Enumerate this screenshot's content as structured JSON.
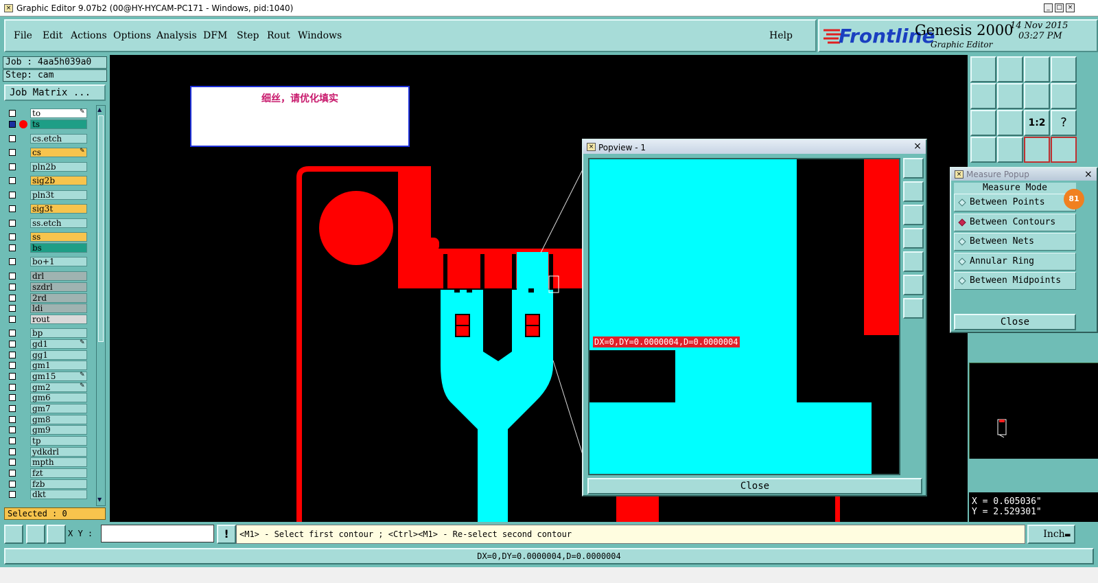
{
  "window": {
    "title": "Graphic Editor 9.07b2 (00@HY-HYCAM-PC171 - Windows, pid:1040)"
  },
  "menu": {
    "items": [
      "File",
      "Edit",
      "Actions",
      "Options",
      "Analysis",
      "DFM",
      "Step",
      "Rout",
      "Windows"
    ],
    "help": "Help"
  },
  "brand": {
    "logo": "Frontline",
    "product": "Genesis 2000",
    "subtitle": "Graphic Editor",
    "date": "14 Nov 2015",
    "time": "03:27 PM"
  },
  "job": {
    "job_label": "Job : 4aa5h039a0",
    "step_label": "Step: cam",
    "matrix_button": "Job Matrix ..."
  },
  "layers": [
    {
      "name": "to",
      "color": "#ffffff",
      "mark": "pen"
    },
    {
      "name": "ts",
      "color": "#1e9e86",
      "mark": "dot"
    },
    {
      "name": "cs.etch",
      "color": "#a7dcd8"
    },
    {
      "name": "cs",
      "color": "#f7c44d",
      "mark": "pen"
    },
    {
      "name": "pln2b",
      "color": "#a7dcd8"
    },
    {
      "name": "sig2b",
      "color": "#f7c44d"
    },
    {
      "name": "pln3t",
      "color": "#a7dcd8"
    },
    {
      "name": "sig3t",
      "color": "#f7c44d"
    },
    {
      "name": "ss.etch",
      "color": "#a7dcd8"
    },
    {
      "name": "ss",
      "color": "#f7c44d"
    },
    {
      "name": "bs",
      "color": "#1e9e86"
    },
    {
      "name": "bo+1",
      "color": "#a7dcd8"
    },
    {
      "name": "drl",
      "color": "#9fb3b1"
    },
    {
      "name": "szdrl",
      "color": "#9fb3b1"
    },
    {
      "name": "2rd",
      "color": "#9fb3b1"
    },
    {
      "name": "ldi",
      "color": "#9fb3b1"
    },
    {
      "name": "rout",
      "color": "#d9d9d9"
    },
    {
      "name": "bp",
      "color": "#a7dcd8"
    },
    {
      "name": "gd1",
      "color": "#a7dcd8",
      "mark": "pen"
    },
    {
      "name": "gg1",
      "color": "#a7dcd8"
    },
    {
      "name": "gm1",
      "color": "#a7dcd8"
    },
    {
      "name": "gm15",
      "color": "#a7dcd8",
      "mark": "pen"
    },
    {
      "name": "gm2",
      "color": "#a7dcd8",
      "mark": "pen"
    },
    {
      "name": "gm6",
      "color": "#a7dcd8"
    },
    {
      "name": "gm7",
      "color": "#a7dcd8"
    },
    {
      "name": "gm8",
      "color": "#a7dcd8"
    },
    {
      "name": "gm9",
      "color": "#a7dcd8"
    },
    {
      "name": "tp",
      "color": "#a7dcd8"
    },
    {
      "name": "ydkdrl",
      "color": "#a7dcd8"
    },
    {
      "name": "mpth",
      "color": "#a7dcd8"
    },
    {
      "name": "fzt",
      "color": "#a7dcd8"
    },
    {
      "name": "fzb",
      "color": "#a7dcd8"
    },
    {
      "name": "dkt",
      "color": "#a7dcd8"
    }
  ],
  "selected": "Selected : 0",
  "note": {
    "text": "细丝，请优化填实"
  },
  "popview": {
    "title": "Popview - 1",
    "measure_label": "DX=0,DY=0.0000004,D=0.0000004",
    "close": "Close"
  },
  "measure_popup": {
    "title": "Measure Popup",
    "header": "Measure Mode",
    "options": [
      {
        "label": "Between Points",
        "selected": false
      },
      {
        "label": "Between Contours",
        "selected": true
      },
      {
        "label": "Between Nets",
        "selected": false
      },
      {
        "label": "Annular Ring",
        "selected": false
      },
      {
        "label": "Between Midpoints",
        "selected": false
      }
    ],
    "close": "Close",
    "badge": "81"
  },
  "coords": {
    "x": "X = 0.605036\"",
    "y": "Y = 2.529301\""
  },
  "command": {
    "xy_label": "X Y :",
    "xy_value": "",
    "warn": "!",
    "prompt": "<M1> - Select first contour ; <Ctrl><M1> - Re-select second contour",
    "unit": "Inch"
  },
  "status": {
    "text": "DX=0,DY=0.0000004,D=0.0000004"
  },
  "colors": {
    "panel": "#6fbdb6",
    "button": "#a7dcd8",
    "copper": "#ff0000",
    "feature": "#00ffff",
    "highlight": "#f7c44d"
  }
}
